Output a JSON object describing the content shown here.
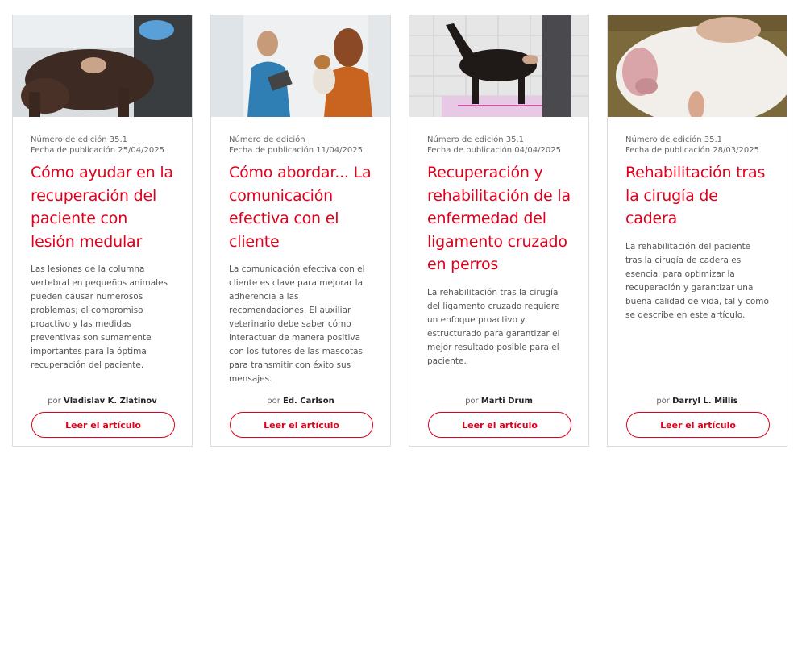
{
  "cards": [
    {
      "issue": "Número de edición 35.1",
      "date": "Fecha de publicación 25/04/2025",
      "title": "Cómo ayudar en la recuperación del paciente con lesión medular",
      "description": "Las lesiones de la columna vertebral en pequeños animales pueden causar numerosos problemas; el compromiso proactivo y las medidas preventivas son sumamente importantes para la óptima recuperación del paciente.",
      "by": "por",
      "author": "Vladislav K. Zlatinov",
      "button": "Leer el artículo"
    },
    {
      "issue": "Número de edición",
      "date": "Fecha de publicación 11/04/2025",
      "title": "Cómo abordar... La comunicación efectiva con el cliente",
      "description": "La comunicación efectiva con el cliente es clave para mejorar la adherencia a las recomendaciones. El auxiliar veterinario debe saber cómo interactuar de manera positiva con los tutores de las mascotas para transmitir con éxito sus mensajes.",
      "by": "por",
      "author": "Ed. Carlson",
      "button": "Leer el artículo"
    },
    {
      "issue": "Número de edición 35.1",
      "date": "Fecha de publicación 04/04/2025",
      "title": "Recuperación y rehabilitación de la enfermedad del ligamento cruzado en perros",
      "description": "La rehabilitación tras la cirugía del ligamento cruzado requiere un enfoque proactivo y estructurado para garantizar el mejor resultado posible para el paciente.",
      "by": "por",
      "author": "Marti Drum",
      "button": "Leer el artículo"
    },
    {
      "issue": "Número de edición 35.1",
      "date": "Fecha de publicación 28/03/2025",
      "title": "Rehabilitación tras la cirugía de cadera",
      "description": "La rehabilitación del paciente tras la cirugía de cadera es esencial para optimizar la recuperación y garantizar una buena calidad de vida, tal y como se describe en este artículo.",
      "by": "por",
      "author": "Darryl L. Millis",
      "button": "Leer el artículo"
    }
  ],
  "colors": {
    "accent": "#e0001b",
    "border": "#dcdcdc",
    "text_muted": "#666666"
  }
}
